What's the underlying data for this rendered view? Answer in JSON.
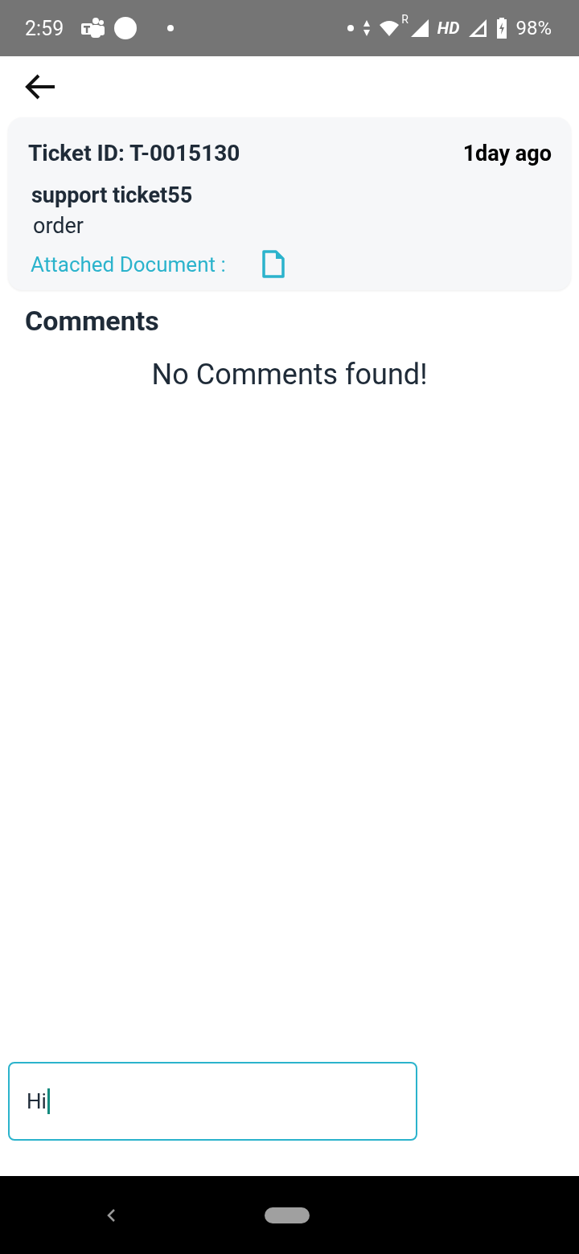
{
  "status_bar": {
    "time": "2:59",
    "roaming": "R",
    "network": "HD",
    "battery": "98%"
  },
  "ticket": {
    "id": "Ticket ID: T-0015130",
    "age": "1day ago",
    "title": "support ticket55",
    "category": "order",
    "attachment_label": "Attached Document :"
  },
  "comments": {
    "heading": "Comments",
    "empty_message": "No Comments found!"
  },
  "message_input": {
    "value": "Hi"
  }
}
